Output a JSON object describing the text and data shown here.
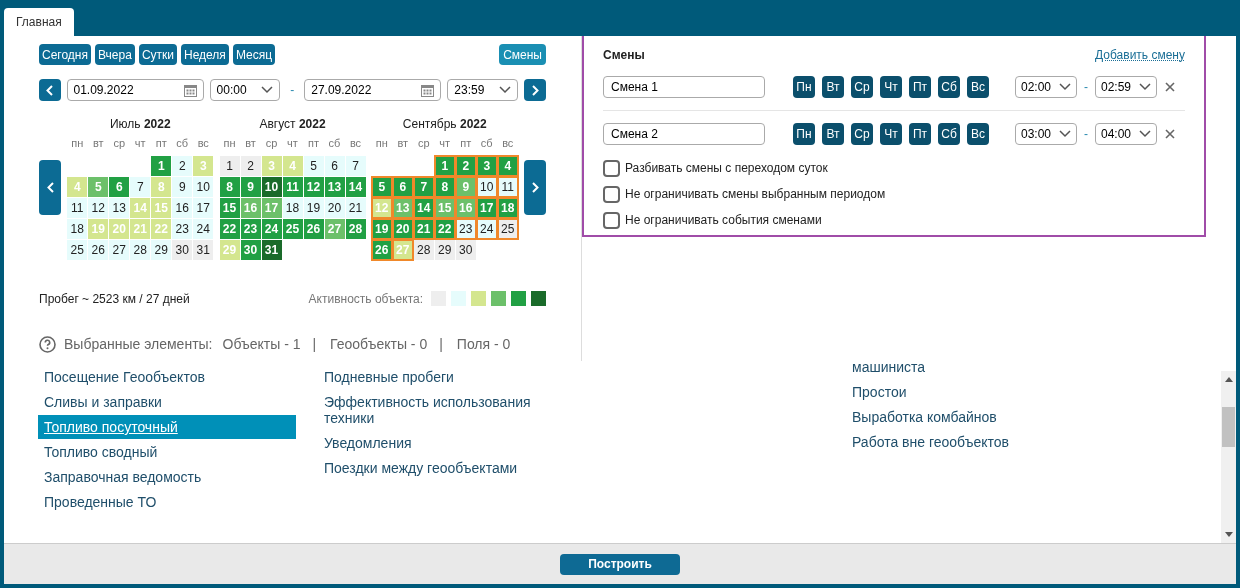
{
  "tabs": [
    {
      "label": "Главная",
      "selected": true
    }
  ],
  "quick_buttons": [
    "Сегодня",
    "Вчера",
    "Сутки",
    "Неделя",
    "Месяц"
  ],
  "shifts_button": "Смены",
  "period": {
    "start_date": "01.09.2022",
    "start_time": "00:00",
    "separator": "-",
    "end_date": "27.09.2022",
    "end_time": "23:59"
  },
  "months": [
    {
      "name": "Июль",
      "year": "2022",
      "weekdays": [
        "пн",
        "вт",
        "ср",
        "чт",
        "пт",
        "сб",
        "вс"
      ],
      "weeks": [
        [
          {
            "day": "1",
            "color": "#21a044",
            "selected": false
          },
          {
            "day": "2",
            "color": "#e6fcfc",
            "selected": false
          },
          {
            "day": "3",
            "color": "#d4e68f",
            "selected": false
          }
        ],
        [
          {
            "day": "4",
            "color": "#d4e68f",
            "selected": false
          },
          {
            "day": "5",
            "color": "#6cc06a",
            "selected": false
          },
          {
            "day": "6",
            "color": "#21a044",
            "selected": false
          },
          {
            "day": "7",
            "color": "#e6fcfc",
            "selected": false
          },
          {
            "day": "8",
            "color": "#d4e68f",
            "selected": false
          },
          {
            "day": "9",
            "color": "#e6fcfc",
            "selected": false
          },
          {
            "day": "10",
            "color": "#e6fcfc",
            "selected": false
          }
        ],
        [
          {
            "day": "11",
            "color": "#e6fcfc",
            "selected": false
          },
          {
            "day": "12",
            "color": "#e6fcfc",
            "selected": false
          },
          {
            "day": "13",
            "color": "#e6fcfc",
            "selected": false
          },
          {
            "day": "14",
            "color": "#d4e68f",
            "selected": false
          },
          {
            "day": "15",
            "color": "#d4e68f",
            "selected": false
          },
          {
            "day": "16",
            "color": "#e6fcfc",
            "selected": false
          },
          {
            "day": "17",
            "color": "#e6fcfc",
            "selected": false
          }
        ],
        [
          {
            "day": "18",
            "color": "#e6fcfc",
            "selected": false
          },
          {
            "day": "19",
            "color": "#d4e68f",
            "selected": false
          },
          {
            "day": "20",
            "color": "#d4e68f",
            "selected": false
          },
          {
            "day": "21",
            "color": "#d4e68f",
            "selected": false
          },
          {
            "day": "22",
            "color": "#d4e68f",
            "selected": false
          },
          {
            "day": "23",
            "color": "#e6fcfc",
            "selected": false
          },
          {
            "day": "24",
            "color": "#e6fcfc",
            "selected": false
          }
        ],
        [
          {
            "day": "25",
            "color": "#e6fcfc",
            "selected": false
          },
          {
            "day": "26",
            "color": "#e6fcfc",
            "selected": false
          },
          {
            "day": "27",
            "color": "#e6fcfc",
            "selected": false
          },
          {
            "day": "28",
            "color": "#e6fcfc",
            "selected": false
          },
          {
            "day": "29",
            "color": "#e6fcfc",
            "selected": false
          },
          {
            "day": "30",
            "color": "#eeeeee",
            "selected": false
          },
          {
            "day": "31",
            "color": "#eeeeee",
            "selected": false
          }
        ]
      ]
    },
    {
      "name": "Август",
      "year": "2022",
      "weekdays": [
        "пн",
        "вт",
        "ср",
        "чт",
        "пт",
        "сб",
        "вс"
      ],
      "weeks": [
        [
          {
            "day": "1",
            "color": "#eeeeee",
            "selected": false
          },
          {
            "day": "2",
            "color": "#eeeeee",
            "selected": false
          },
          {
            "day": "3",
            "color": "#d4e68f",
            "selected": false
          },
          {
            "day": "4",
            "color": "#d4e68f",
            "selected": false
          },
          {
            "day": "5",
            "color": "#e6fcfc",
            "selected": false
          },
          {
            "day": "6",
            "color": "#e6fcfc",
            "selected": false
          },
          {
            "day": "7",
            "color": "#e6fcfc",
            "selected": false
          }
        ],
        [
          {
            "day": "8",
            "color": "#21a044",
            "selected": false
          },
          {
            "day": "9",
            "color": "#21a044",
            "selected": false
          },
          {
            "day": "10",
            "color": "#1a6b2a",
            "selected": false
          },
          {
            "day": "11",
            "color": "#21a044",
            "selected": false
          },
          {
            "day": "12",
            "color": "#21a044",
            "selected": false
          },
          {
            "day": "13",
            "color": "#21a044",
            "selected": false
          },
          {
            "day": "14",
            "color": "#21a044",
            "selected": false
          }
        ],
        [
          {
            "day": "15",
            "color": "#21a044",
            "selected": false
          },
          {
            "day": "16",
            "color": "#6cc06a",
            "selected": false
          },
          {
            "day": "17",
            "color": "#6cc06a",
            "selected": false
          },
          {
            "day": "18",
            "color": "#e6fcfc",
            "selected": false
          },
          {
            "day": "19",
            "color": "#e6fcfc",
            "selected": false
          },
          {
            "day": "20",
            "color": "#e6fcfc",
            "selected": false
          },
          {
            "day": "21",
            "color": "#e6fcfc",
            "selected": false
          }
        ],
        [
          {
            "day": "22",
            "color": "#21a044",
            "selected": false
          },
          {
            "day": "23",
            "color": "#21a044",
            "selected": false
          },
          {
            "day": "24",
            "color": "#21a044",
            "selected": false
          },
          {
            "day": "25",
            "color": "#21a044",
            "selected": false
          },
          {
            "day": "26",
            "color": "#21a044",
            "selected": false
          },
          {
            "day": "27",
            "color": "#6cc06a",
            "selected": false
          },
          {
            "day": "28",
            "color": "#21a044",
            "selected": false
          }
        ],
        [
          {
            "day": "29",
            "color": "#d4e68f",
            "selected": false
          },
          {
            "day": "30",
            "color": "#21a044",
            "selected": false
          },
          {
            "day": "31",
            "color": "#1a6b2a",
            "selected": false
          }
        ]
      ]
    },
    {
      "name": "Сентябрь",
      "year": "2022",
      "weekdays": [
        "пн",
        "вт",
        "ср",
        "чт",
        "пт",
        "сб",
        "вс"
      ],
      "weeks": [
        [
          {
            "day": "1",
            "color": "#21a044",
            "selected": true
          },
          {
            "day": "2",
            "color": "#21a044",
            "selected": true
          },
          {
            "day": "3",
            "color": "#21a044",
            "selected": true
          },
          {
            "day": "4",
            "color": "#21a044",
            "selected": true
          }
        ],
        [
          {
            "day": "5",
            "color": "#21a044",
            "selected": true
          },
          {
            "day": "6",
            "color": "#21a044",
            "selected": true
          },
          {
            "day": "7",
            "color": "#21a044",
            "selected": true
          },
          {
            "day": "8",
            "color": "#21a044",
            "selected": true
          },
          {
            "day": "9",
            "color": "#6cc06a",
            "selected": true
          },
          {
            "day": "10",
            "color": "#e6fcfc",
            "selected": true
          },
          {
            "day": "11",
            "color": "#e6fcfc",
            "selected": true
          }
        ],
        [
          {
            "day": "12",
            "color": "#d4e68f",
            "selected": true
          },
          {
            "day": "13",
            "color": "#6cc06a",
            "selected": true
          },
          {
            "day": "14",
            "color": "#21a044",
            "selected": true
          },
          {
            "day": "15",
            "color": "#6cc06a",
            "selected": true
          },
          {
            "day": "16",
            "color": "#6cc06a",
            "selected": true
          },
          {
            "day": "17",
            "color": "#21a044",
            "selected": true
          },
          {
            "day": "18",
            "color": "#21a044",
            "selected": true
          }
        ],
        [
          {
            "day": "19",
            "color": "#21a044",
            "selected": true
          },
          {
            "day": "20",
            "color": "#21a044",
            "selected": true
          },
          {
            "day": "21",
            "color": "#21a044",
            "selected": true
          },
          {
            "day": "22",
            "color": "#21a044",
            "selected": true
          },
          {
            "day": "23",
            "color": "#e6fcfc",
            "selected": true
          },
          {
            "day": "24",
            "color": "#e6fcfc",
            "selected": true
          },
          {
            "day": "25",
            "color": "#eeeeee",
            "selected": true
          }
        ],
        [
          {
            "day": "26",
            "color": "#21a044",
            "selected": true
          },
          {
            "day": "27",
            "color": "#d4e68f",
            "selected": true
          },
          {
            "day": "28",
            "color": "#eeeeee",
            "selected": false
          },
          {
            "day": "29",
            "color": "#eeeeee",
            "selected": false
          },
          {
            "day": "30",
            "color": "#eeeeee",
            "selected": false
          }
        ]
      ]
    }
  ],
  "mileage": "Пробег ~ 2523 км / 27 дней",
  "activity": {
    "label": "Активность объекта:",
    "levels": [
      {
        "color": "#eeeeee"
      },
      {
        "color": "#e6fcfc"
      },
      {
        "color": "#d4e68f"
      },
      {
        "color": "#6cc06a"
      },
      {
        "color": "#21a044"
      },
      {
        "color": "#1a6b2a"
      }
    ]
  },
  "selected_elements": {
    "label": "Выбранные элементы:",
    "items": [
      "Объекты - 1",
      "Геообъекты - 0",
      "Поля - 0"
    ],
    "separator": "|"
  },
  "shifts": {
    "title": "Смены",
    "add_link": "Добавить смену",
    "rows": [
      {
        "name": "Смена 1",
        "days": [
          {
            "label": "Пн",
            "selected": true
          },
          {
            "label": "Вт",
            "selected": true
          },
          {
            "label": "Ср",
            "selected": true
          },
          {
            "label": "Чт",
            "selected": true
          },
          {
            "label": "Пт",
            "selected": true
          },
          {
            "label": "Сб",
            "selected": true
          },
          {
            "label": "Вс",
            "selected": true
          }
        ],
        "start": "02:00",
        "separator": "-",
        "end": "02:59"
      },
      {
        "name": "Смена 2",
        "days": [
          {
            "label": "Пн",
            "selected": true
          },
          {
            "label": "Вт",
            "selected": true
          },
          {
            "label": "Ср",
            "selected": true
          },
          {
            "label": "Чт",
            "selected": true
          },
          {
            "label": "Пт",
            "selected": true
          },
          {
            "label": "Сб",
            "selected": true
          },
          {
            "label": "Вс",
            "selected": true
          }
        ],
        "start": "03:00",
        "separator": "-",
        "end": "04:00"
      }
    ],
    "options": [
      {
        "label": "Разбивать смены с переходом суток",
        "checked": false
      },
      {
        "label": "Не ограничивать смены выбранным периодом",
        "checked": false
      },
      {
        "label": "Не ограничивать события сменами",
        "checked": false
      }
    ]
  },
  "reports": [
    [
      {
        "label": "Посещение Геообъектов",
        "selected": false
      },
      {
        "label": "Сливы и заправки",
        "selected": false
      },
      {
        "label": "Топливо посуточный",
        "selected": true
      },
      {
        "label": "Топливо сводный",
        "selected": false
      },
      {
        "label": "Заправочная ведомость",
        "selected": false
      },
      {
        "label": "Проведенные ТО",
        "selected": false
      }
    ],
    [
      {
        "label": "Подневные пробеги",
        "selected": false
      },
      {
        "label": "Эффективность использования техники",
        "selected": false
      },
      {
        "label": "Уведомления",
        "selected": false
      },
      {
        "label": "Поездки между геообъектами",
        "selected": false
      }
    ],
    [
      {
        "label": "машиниста",
        "selected": false
      },
      {
        "label": "Простои",
        "selected": false
      },
      {
        "label": "Выработка комбайнов",
        "selected": false
      },
      {
        "label": "Работа вне геообъектов",
        "selected": false
      }
    ]
  ],
  "build_button": "Построить"
}
